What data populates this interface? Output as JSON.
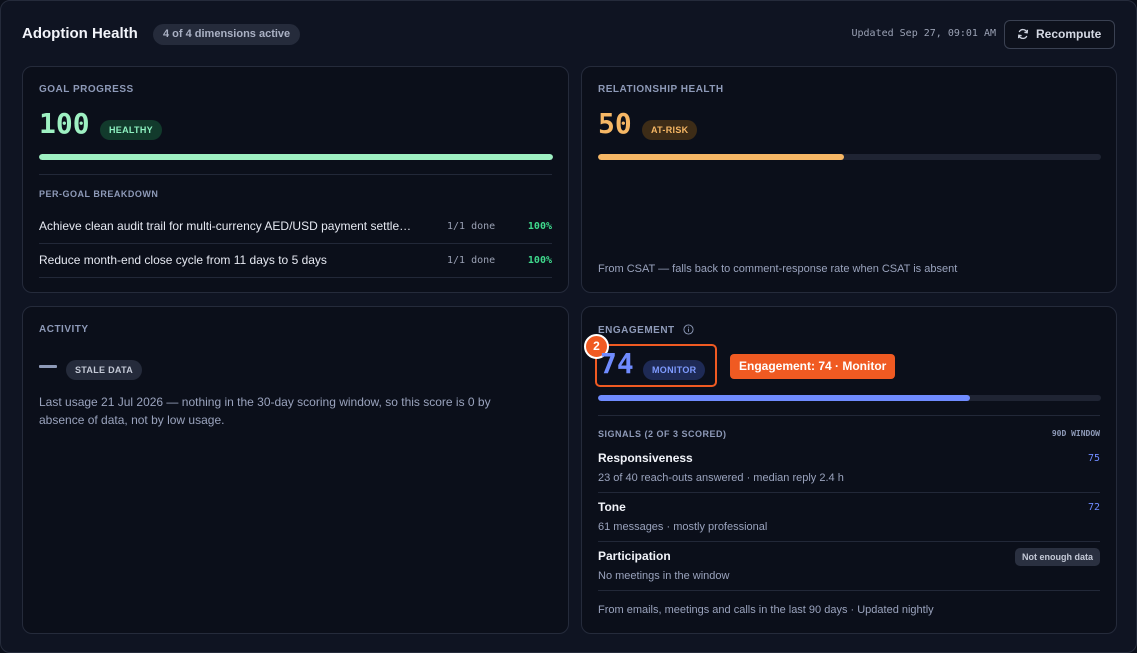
{
  "header": {
    "title": "Adoption Health",
    "dimensions_pill": "4 of 4 dimensions active",
    "updated": "Updated Sep 27, 09:01 AM",
    "recompute_label": "Recompute"
  },
  "goal_progress": {
    "label": "GOAL PROGRESS",
    "score": "100",
    "status": "HEALTHY",
    "progress": 1.0,
    "breakdown_label": "PER-GOAL BREAKDOWN",
    "goals": [
      {
        "text": "Achieve clean audit trail for multi-currency AED/USD payment settle…",
        "done": "1/1 done",
        "pct": "100%"
      },
      {
        "text": "Reduce month-end close cycle from 11 days to 5 days",
        "done": "1/1 done",
        "pct": "100%"
      }
    ]
  },
  "relationship_health": {
    "label": "RELATIONSHIP HEALTH",
    "score": "50",
    "status": "AT-RISK",
    "progress": 0.49,
    "footnote": "From CSAT — falls back to comment-response rate when CSAT is absent"
  },
  "activity": {
    "label": "ACTIVITY",
    "score": "—",
    "status": "STALE DATA",
    "description": "Last usage 21 Jul 2026 — nothing in the 30-day scoring window, so this score is 0 by absence of data, not by low usage."
  },
  "engagement": {
    "label": "ENGAGEMENT",
    "marker": "2",
    "score": "74",
    "status": "MONITOR",
    "tooltip": "Engagement: 74 · Monitor",
    "progress": 0.74,
    "signals_label": "SIGNALS (2 OF 3 SCORED)",
    "window": "90D WINDOW",
    "signals": [
      {
        "name": "Responsiveness",
        "desc": "23 of 40 reach-outs answered · median reply 2.4 h",
        "value": "75"
      },
      {
        "name": "Tone",
        "desc": "61 messages · mostly professional",
        "value": "72"
      },
      {
        "name": "Participation",
        "desc": "No meetings in the window",
        "value": "Not enough data"
      }
    ],
    "footnote": "From emails, meetings and calls in the last 90 days · Updated nightly"
  },
  "colors": {
    "healthy": "#9ef0c2",
    "at_risk": "#f6b765",
    "monitor": "#6f8bff",
    "highlight": "#f05a22"
  },
  "icons": {
    "recompute": "refresh-icon",
    "info": "info-icon"
  }
}
